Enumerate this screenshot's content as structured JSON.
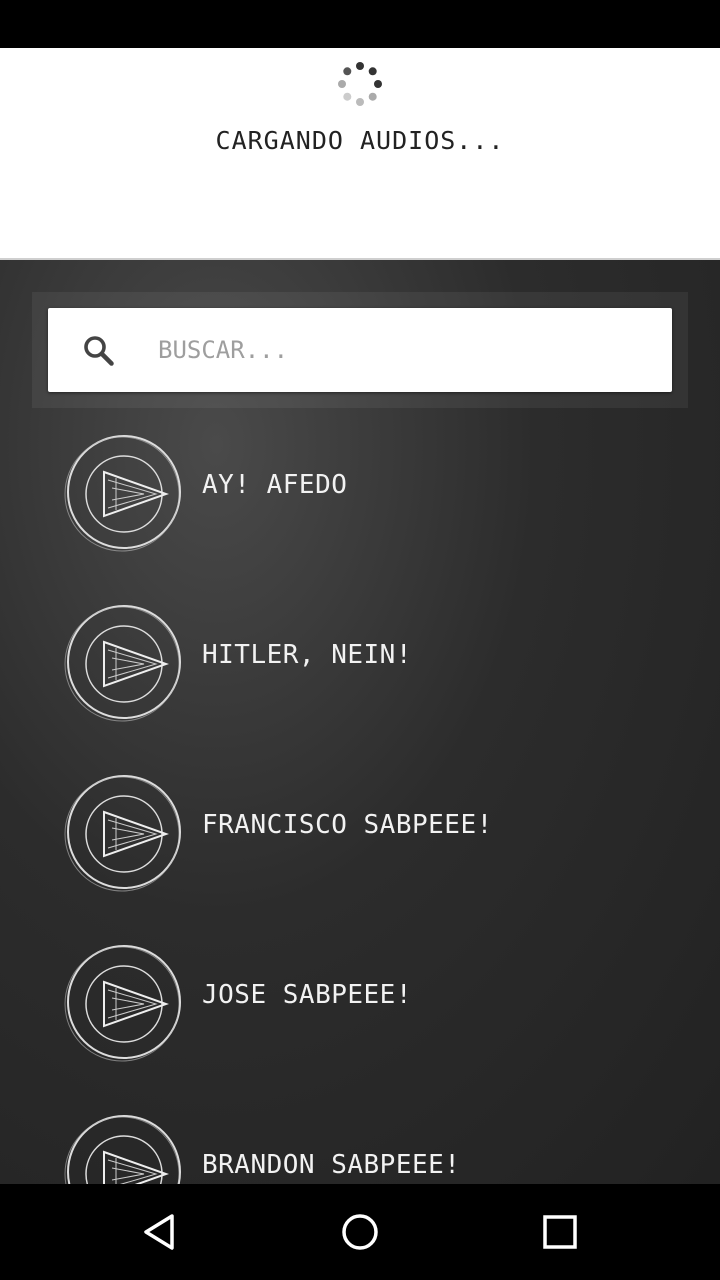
{
  "loading": {
    "message": "CARGANDO AUDIOS..."
  },
  "search": {
    "placeholder": "BUSCAR..."
  },
  "sounds": [
    {
      "label": "AY! AFEDO"
    },
    {
      "label": "HITLER, NEIN!"
    },
    {
      "label": "FRANCISCO SABPEEE!"
    },
    {
      "label": "JOSE SABPEEE!"
    },
    {
      "label": "BRANDON SABPEEE!"
    }
  ],
  "colors": {
    "chalkboard": "#2c2c2c",
    "chalk": "#f2f2f2",
    "dialog": "#ffffff"
  },
  "icons": {
    "search": "search-icon",
    "play": "play-icon",
    "back": "back-icon",
    "home": "home-icon",
    "recents": "recents-icon"
  }
}
